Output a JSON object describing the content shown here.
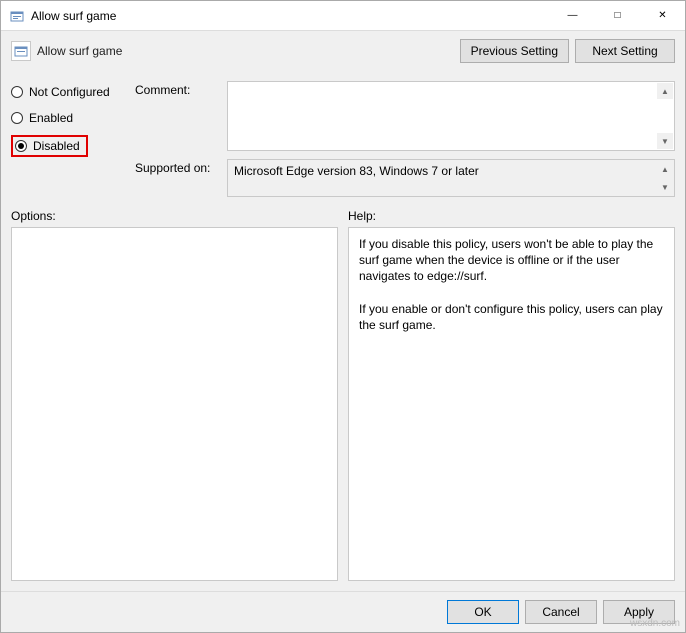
{
  "window": {
    "title": "Allow surf game",
    "controls": {
      "minimize": "—",
      "maximize": "□",
      "close": "✕"
    }
  },
  "header": {
    "title": "Allow surf game",
    "previous": "Previous Setting",
    "next": "Next Setting"
  },
  "radios": {
    "not_configured": "Not Configured",
    "enabled": "Enabled",
    "disabled": "Disabled",
    "selected": "disabled"
  },
  "labels": {
    "comment": "Comment:",
    "supported": "Supported on:",
    "options": "Options:",
    "help": "Help:"
  },
  "fields": {
    "comment": "",
    "supported": "Microsoft Edge version 83, Windows 7 or later",
    "options": "",
    "help": "If you disable this policy, users won't be able to play the surf game when the device is offline or if the user navigates to edge://surf.\n\nIf you enable or don't configure this policy, users can play the surf game."
  },
  "footer": {
    "ok": "OK",
    "cancel": "Cancel",
    "apply": "Apply"
  },
  "watermark": "wsxdn.com"
}
